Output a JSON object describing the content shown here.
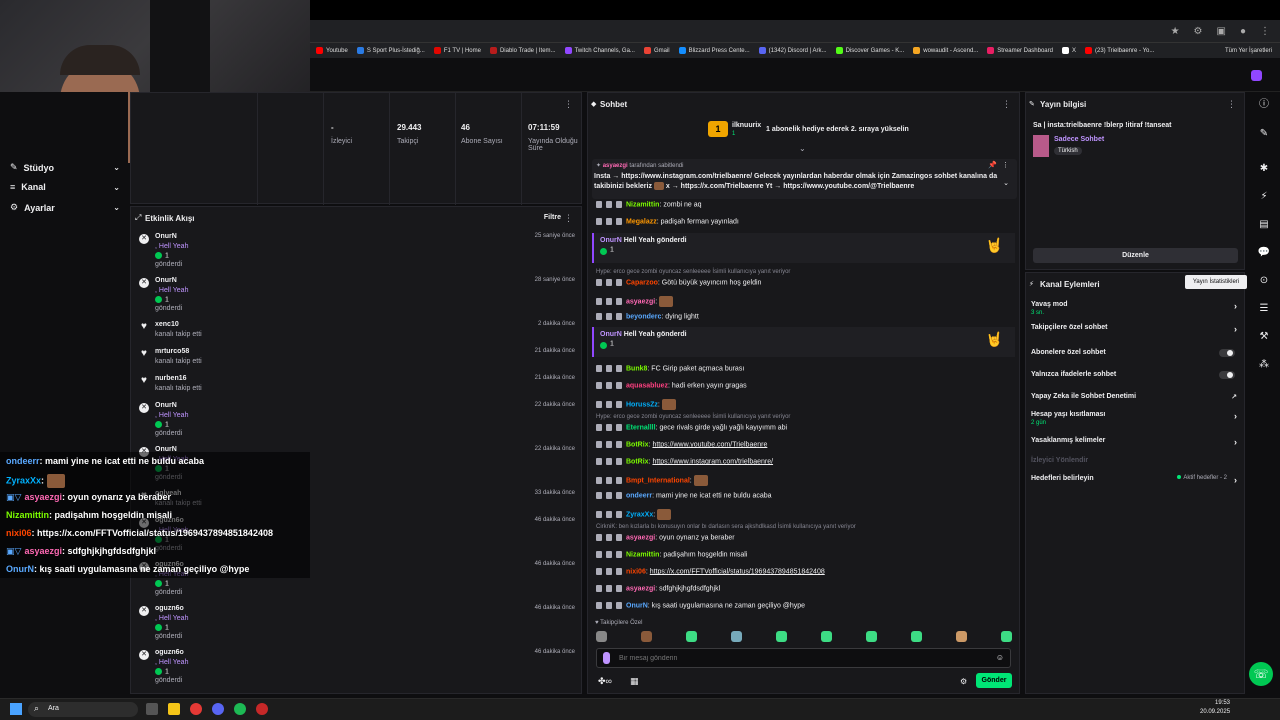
{
  "bookmarks": [
    {
      "label": "Youtube",
      "color": "#ff0000"
    },
    {
      "label": "S Sport Plus-İstediğ...",
      "color": "#2a7be4"
    },
    {
      "label": "F1 TV | Home",
      "color": "#e10600"
    },
    {
      "label": "Diablo Trade | Item...",
      "color": "#b71c1c"
    },
    {
      "label": "Twitch Channels, Ga...",
      "color": "#9147ff"
    },
    {
      "label": "Gmail",
      "color": "#ea4335"
    },
    {
      "label": "Blizzard Press Cente...",
      "color": "#148eff"
    },
    {
      "label": "(1342) Discord | Ark...",
      "color": "#5865f2"
    },
    {
      "label": "Discover Games - K...",
      "color": "#53fc18"
    },
    {
      "label": "wowaudit - Ascend...",
      "color": "#f5a623"
    },
    {
      "label": "Streamer Dashboard",
      "color": "#e91e63"
    },
    {
      "label": "X",
      "color": "#ffffff"
    },
    {
      "label": "(23) Trielbaenre - Yo...",
      "color": "#ff0000"
    }
  ],
  "bookmarks_other": "Tüm Yer İşaretleri",
  "nav": {
    "studio": "Stüdyo",
    "channel": "Kanal",
    "settings": "Ayarlar"
  },
  "stats": [
    {
      "value": "-",
      "label": "İzleyici"
    },
    {
      "value": "29.443",
      "label": "Takipçi"
    },
    {
      "value": "46",
      "label": "Abone Sayısı"
    },
    {
      "value": "07:11:59",
      "label": "Yayında Olduğu Süre"
    }
  ],
  "activity": {
    "title": "Etkinlik Akışı",
    "filter": "Filtre",
    "items": [
      {
        "type": "cheer",
        "name": "OnurN",
        "l2": ", Hell Yeah",
        "l3": "1",
        "l4": "gönderdi",
        "time": "25 saniye önce"
      },
      {
        "type": "cheer",
        "name": "OnurN",
        "l2": ", Hell Yeah",
        "l3": "1",
        "l4": "gönderdi",
        "time": "28 saniye önce"
      },
      {
        "type": "follow",
        "name": "xenc10",
        "l2": "kanalı takip etti",
        "time": "2 dakika önce"
      },
      {
        "type": "follow",
        "name": "mrturco58",
        "l2": "kanalı takip etti",
        "time": "21 dakika önce"
      },
      {
        "type": "follow",
        "name": "nurben16",
        "l2": "kanalı takip etti",
        "time": "21 dakika önce"
      },
      {
        "type": "cheer",
        "name": "OnurN",
        "l2": ", Hell Yeah",
        "l3": "1",
        "l4": "gönderdi",
        "time": "22 dakika önce"
      },
      {
        "type": "cheer",
        "name": "OnurN",
        "l2": ", Hell Yeah",
        "l3": "1",
        "l4": "gönderdi",
        "time": "22 dakika önce"
      },
      {
        "type": "follow",
        "name": "oglveah",
        "l2": "kanalı takip etti",
        "time": "33 dakika önce"
      },
      {
        "type": "cheer",
        "name": "oguzn6o",
        "l2": ", Hell Yeah",
        "l3": "1",
        "l4": "gönderdi",
        "time": "46 dakika önce"
      },
      {
        "type": "cheer",
        "name": "oguzn6o",
        "l2": ", Hell Yeah",
        "l3": "1",
        "l4": "gönderdi",
        "time": "46 dakika önce"
      },
      {
        "type": "cheer",
        "name": "oguzn6o",
        "l2": ", Hell Yeah",
        "l3": "1",
        "l4": "gönderdi",
        "time": "46 dakika önce"
      },
      {
        "type": "cheer",
        "name": "oguzn6o",
        "l2": ", Hell Yeah",
        "l3": "1",
        "l4": "gönderdi",
        "time": "46 dakika önce"
      }
    ]
  },
  "overlay": [
    {
      "user": "ondeerr",
      "text": ": mami yine ne icat etti ne buldu acaba",
      "color": "#5aa9ff"
    },
    {
      "user": "ZyraxXx",
      "text": ":",
      "color": "#00b2ff",
      "emote": true
    },
    {
      "user": "asyaezgi",
      "text": ": oyun oynarız ya beraber",
      "color": "#ff69b4"
    },
    {
      "user": "Nizamittin",
      "text": ": padişahım hoşgeldin misali",
      "color": "#7cfc00"
    },
    {
      "user": "nixi06",
      "text": ": https://x.com/FFTVofficial/status/1969437894851842408",
      "color": "#ff4500"
    },
    {
      "user": "asyaezgi",
      "text": ": sdfghjkjhgfdsdfghjkl",
      "color": "#ff69b4"
    },
    {
      "user": "OnurN",
      "text": ": kış saati uygulamasına ne zaman geçiliyo @hype",
      "color": "#5aa9ff"
    }
  ],
  "chat": {
    "title": "Sohbet",
    "top_user": "ilknuurix",
    "top_count": "1",
    "top_text": "1 abonelik hediye ederek 2. sıraya yükselin",
    "pinned_by": "asyaezgi",
    "pinned_suffix": "tarafından sabitlendi",
    "pinned_text1": "Insta →",
    "pinned_link1": "https://www.instagram.com/trielbaenre/",
    "pinned_text2": "Gelecek yayınlardan haberdar olmak için Zamazingos sohbet kanalına",
    "pinned_text3": "da takibinizi bekleriz",
    "pinned_text4": "x →",
    "pinned_link2": "https://x.com/Trielbaenre",
    "pinned_text5": "Yt →",
    "pinned_link3": "https://www.youtube.com/@Trielbaenre",
    "cheer_user": "OnurN",
    "cheer_text": "Hell Yeah gönderdi",
    "cheer_count": "1",
    "hint1": "Hype: erco gece zombi oyuncaz senleeeee İsimli kullanıcıya yanıt veriyor",
    "hint2": "Hype: erco gece zombi oyuncaz senleeeee İsimli kullanıcıya yanıt veriyor",
    "hint3": "CirkniK: ben kızlarla bı konusuyın onlar bı darlasın sera ajkshdlkasd İsimli kullanıcıya yanıt veriyor",
    "messages_a": [
      {
        "user": "Nizamittin",
        "text": ": zombi ne aq",
        "color": "#7cfc00"
      },
      {
        "user": "Megalazz",
        "text": ": padişah ferman yayınladı",
        "color": "#ff9800"
      }
    ],
    "messages_b": [
      {
        "user": "Caparzoo",
        "text": ": Götü büyük yayıncım hoş geldin",
        "color": "#ff4500"
      },
      {
        "user": "asyaezgi",
        "text": ":",
        "color": "#ff69b4",
        "emote": true
      },
      {
        "user": "beyonderc",
        "text": ": dying lightt",
        "color": "#5aa9ff"
      }
    ],
    "messages_c": [
      {
        "user": "Bunk8",
        "text": ": FC Girip paket açmaca burası",
        "color": "#7cfc00"
      },
      {
        "user": "aquasabluez",
        "text": ": hadi erken yayın gragas",
        "color": "#ff4081"
      },
      {
        "user": "HorussZz",
        "text": ":",
        "color": "#00b2ff",
        "emote": true
      }
    ],
    "messages_d": [
      {
        "user": "Eternallll",
        "text": ": gece rivals girde yağlı yağlı kayıyımm abi",
        "color": "#00e676"
      },
      {
        "user": "BotRix",
        "text": ": ",
        "link": "https://www.youtube.com/Trielbaenre",
        "color": "#7cfc00"
      },
      {
        "user": "BotRix",
        "text": ": ",
        "link": "https://www.instagram.com/trielbaenre/",
        "color": "#7cfc00"
      },
      {
        "user": "Bmpt_International",
        "text": ":",
        "color": "#ff4500",
        "emote": true
      },
      {
        "user": "ondeerr",
        "text": ": mami yine ne icat etti ne buldu acaba",
        "color": "#5aa9ff"
      },
      {
        "user": "ZyraxXx",
        "text": ":",
        "color": "#00b2ff",
        "emote": true
      }
    ],
    "messages_e": [
      {
        "user": "asyaezgi",
        "text": ": oyun oynarız ya beraber",
        "color": "#ff69b4"
      },
      {
        "user": "Nizamittin",
        "text": ": padişahım hoşgeldin misali",
        "color": "#7cfc00"
      },
      {
        "user": "nixi06",
        "text": ": ",
        "link": "https://x.com/FFTVofficial/status/1969437894851842408",
        "color": "#ff4500"
      },
      {
        "user": "asyaezgi",
        "text": ": sdfghjkjhgfdsdfghjkl",
        "color": "#ff69b4"
      },
      {
        "user": "OnurN",
        "text": ": kış saati uygulamasına ne zaman geçiliyo @hype",
        "color": "#5aa9ff"
      }
    ],
    "follower_only": "Takipçilere Özel",
    "placeholder": "Bir mesaj gönderin",
    "send": "Gönder"
  },
  "info": {
    "title": "Yayın bilgisi",
    "stream_title": "Sa | insta:trielbaenre !blerp !itiraf !tanseat",
    "category": "Sadece Sohbet",
    "tag": "Türkish",
    "edit": "Düzenle"
  },
  "actions": {
    "title": "Kanal Eylemleri",
    "tooltip": "Yayın İstatistikleri",
    "items": [
      {
        "label": "Yavaş mod",
        "sub": "3 sn."
      },
      {
        "label": "Takipçilere özel sohbet",
        "sub": ""
      },
      {
        "label": "Abonelere özel sohbet",
        "sub": ""
      },
      {
        "label": "Yalnızca ifadelerle sohbet",
        "sub": ""
      },
      {
        "label": "Yapay Zeka ile Sohbet Denetimi",
        "sub": ""
      },
      {
        "label": "Hesap yaşı kısıtlaması",
        "sub": "2 gün"
      },
      {
        "label": "Yasaklanmış kelimeler",
        "sub": ""
      },
      {
        "label": "İzleyici Yönlendir",
        "sub": ""
      },
      {
        "label": "Hedefleri belirleyin",
        "sub": ""
      }
    ],
    "goals_status": "Aktif hedefler - 2"
  },
  "taskbar": {
    "search": "Ara",
    "time": "19:53",
    "date": "20.09.2025"
  },
  "colors": {
    "accent": "#9147ff",
    "send": "#00e676"
  }
}
